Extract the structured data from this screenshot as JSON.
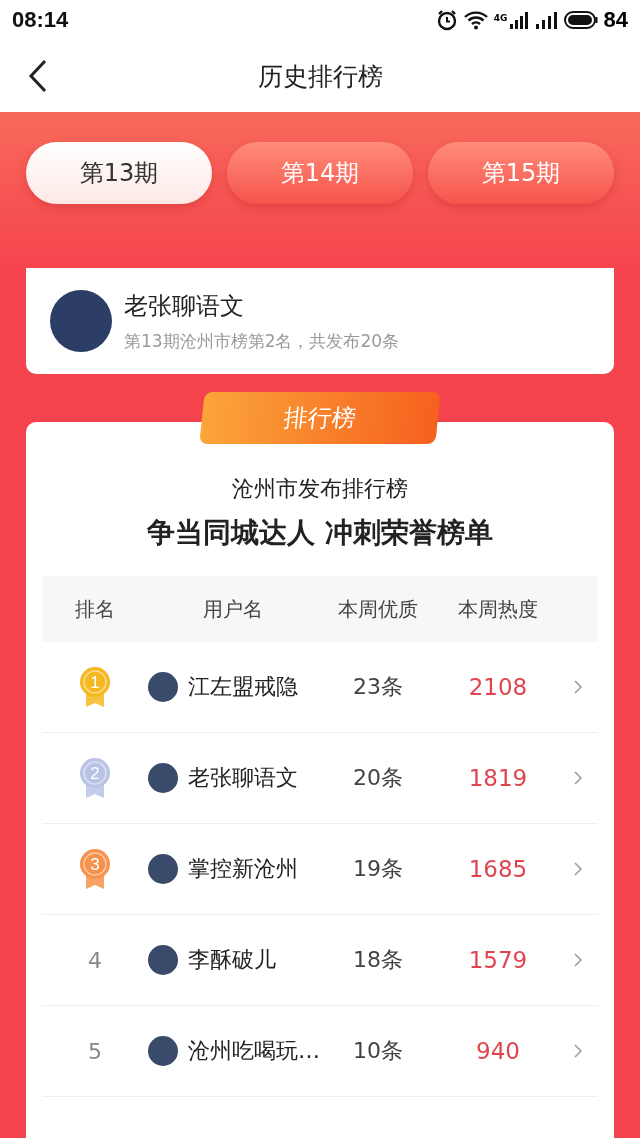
{
  "status_bar": {
    "time": "08:14",
    "network": "4G",
    "battery": "84"
  },
  "header": {
    "title": "历史排行榜"
  },
  "periods": [
    {
      "label": "第13期",
      "selected": true
    },
    {
      "label": "第14期",
      "selected": false
    },
    {
      "label": "第15期",
      "selected": false
    }
  ],
  "profile": {
    "name": "老张聊语文",
    "summary": "第13期沧州市榜第2名，共发布20条"
  },
  "ranking_badge": "排行榜",
  "board": {
    "title": "沧州市发布排行榜",
    "slogan": "争当同城达人 冲刺荣誉榜单",
    "columns": [
      "排名",
      "用户名",
      "本周优质",
      "本周热度"
    ],
    "rows": [
      {
        "kind": "medal",
        "rank": "1",
        "color": "#f5b820",
        "name": "江左盟戒隐",
        "posts": "23条",
        "heat": "2108"
      },
      {
        "kind": "medal",
        "rank": "2",
        "color": "#b9c3e6",
        "name": "老张聊语文",
        "posts": "20条",
        "heat": "1819"
      },
      {
        "kind": "medal",
        "rank": "3",
        "color": "#f7924a",
        "name": "掌控新沧州",
        "posts": "19条",
        "heat": "1685"
      },
      {
        "kind": "plain",
        "rank": "4",
        "name": "李酥破儿",
        "posts": "18条",
        "heat": "1579"
      },
      {
        "kind": "plain",
        "rank": "5",
        "name": "沧州吃喝玩…",
        "posts": "10条",
        "heat": "940"
      }
    ]
  }
}
